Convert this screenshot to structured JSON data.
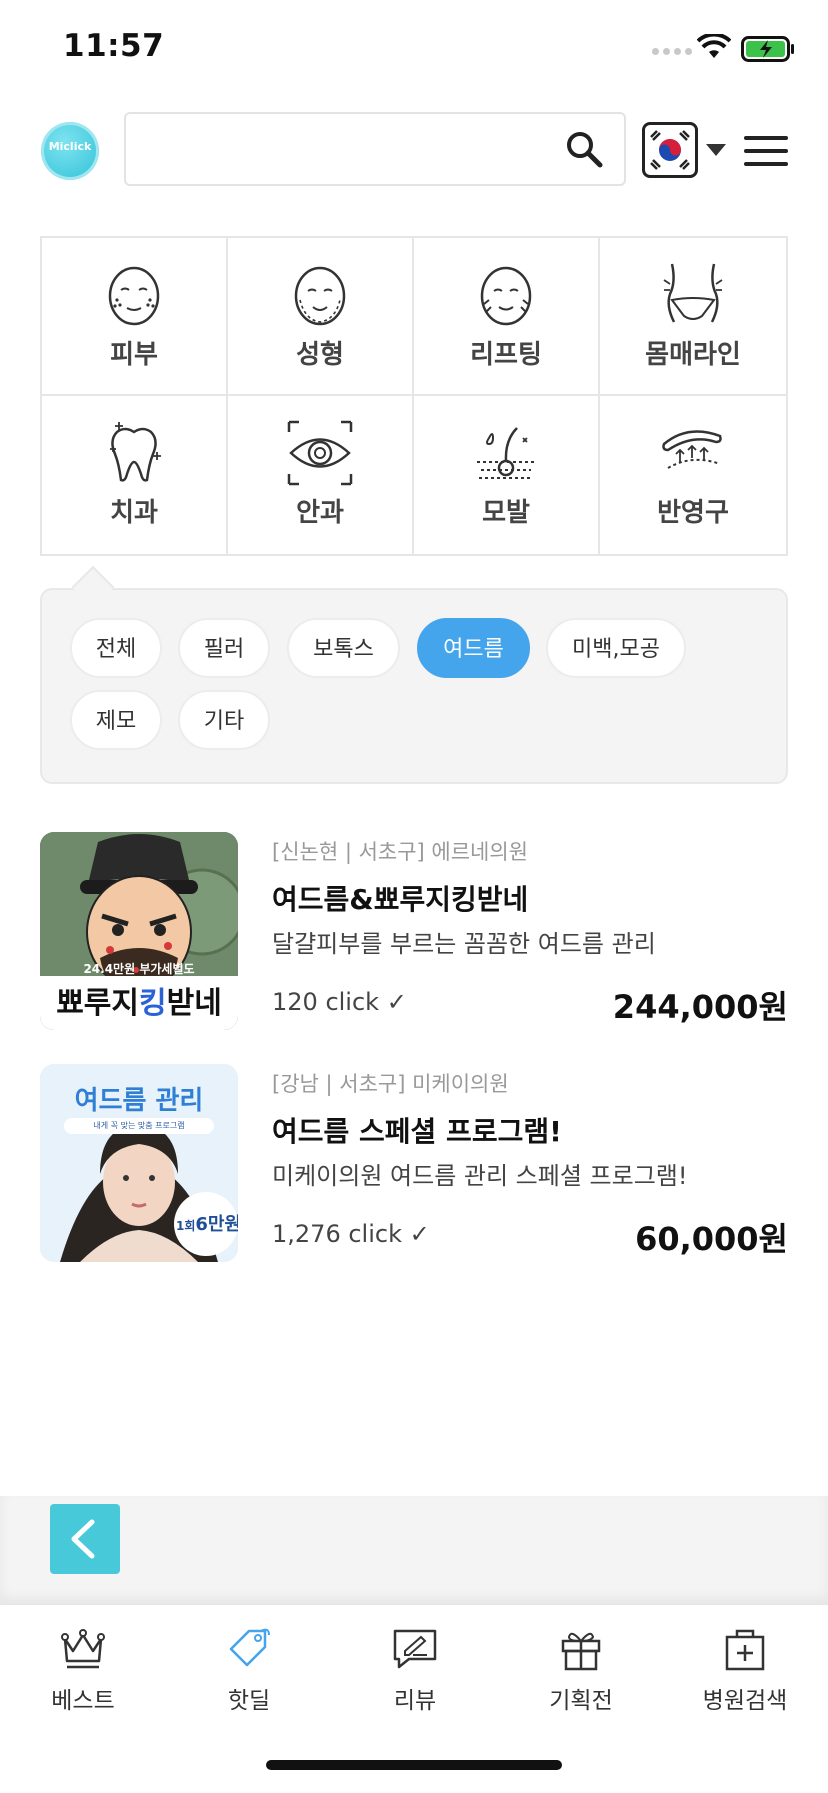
{
  "status_bar": {
    "time": "11:57"
  },
  "header": {
    "logo_text": "Miclick",
    "search": {
      "value": "",
      "placeholder": ""
    }
  },
  "categories": [
    {
      "label": "피부",
      "icon": "face-acne-icon"
    },
    {
      "label": "성형",
      "icon": "face-outline-icon"
    },
    {
      "label": "리프팅",
      "icon": "face-lift-icon"
    },
    {
      "label": "몸매라인",
      "icon": "body-line-icon"
    },
    {
      "label": "치과",
      "icon": "tooth-icon"
    },
    {
      "label": "안과",
      "icon": "eye-icon"
    },
    {
      "label": "모발",
      "icon": "hair-follicle-icon"
    },
    {
      "label": "반영구",
      "icon": "eyebrow-icon"
    }
  ],
  "filters": {
    "chips": [
      "전체",
      "필러",
      "보톡스",
      "여드름",
      "미백,모공",
      "제모",
      "기타"
    ],
    "active": "여드름"
  },
  "products": [
    {
      "meta": "[신논현 | 서초구] 에르네의원",
      "title": "여드름&뾰루지킹받네",
      "desc": "달걀피부를 부르는 꼼꼼한 여드름 관리",
      "clicks": "120  click ✓",
      "price": "244,000원",
      "thumb_top": "24.4만원 부가세별도",
      "thumb_main_a": "뾰루지",
      "thumb_main_b": "킹",
      "thumb_main_c": "받네"
    },
    {
      "meta": "[강남 | 서초구] 미케이의원",
      "title": "여드름 스페셜 프로그램!",
      "desc": "미케이의원 여드름 관리 스페셜 프로그램!",
      "clicks": "1,276  click ✓",
      "price": "60,000원",
      "thumb_title": "여드름 관리",
      "thumb_sub": "내게 꼭 맞는 맞춤 프로그램",
      "thumb_badge_a": "1회",
      "thumb_badge_b": "6만원"
    }
  ],
  "tabs": [
    {
      "label": "베스트",
      "icon": "crown-icon"
    },
    {
      "label": "핫딜",
      "icon": "tag-icon"
    },
    {
      "label": "리뷰",
      "icon": "review-icon"
    },
    {
      "label": "기획전",
      "icon": "gift-icon"
    },
    {
      "label": "병원검색",
      "icon": "hospital-icon"
    }
  ],
  "colors": {
    "accent": "#44a4ec",
    "teal": "#47c9da"
  }
}
